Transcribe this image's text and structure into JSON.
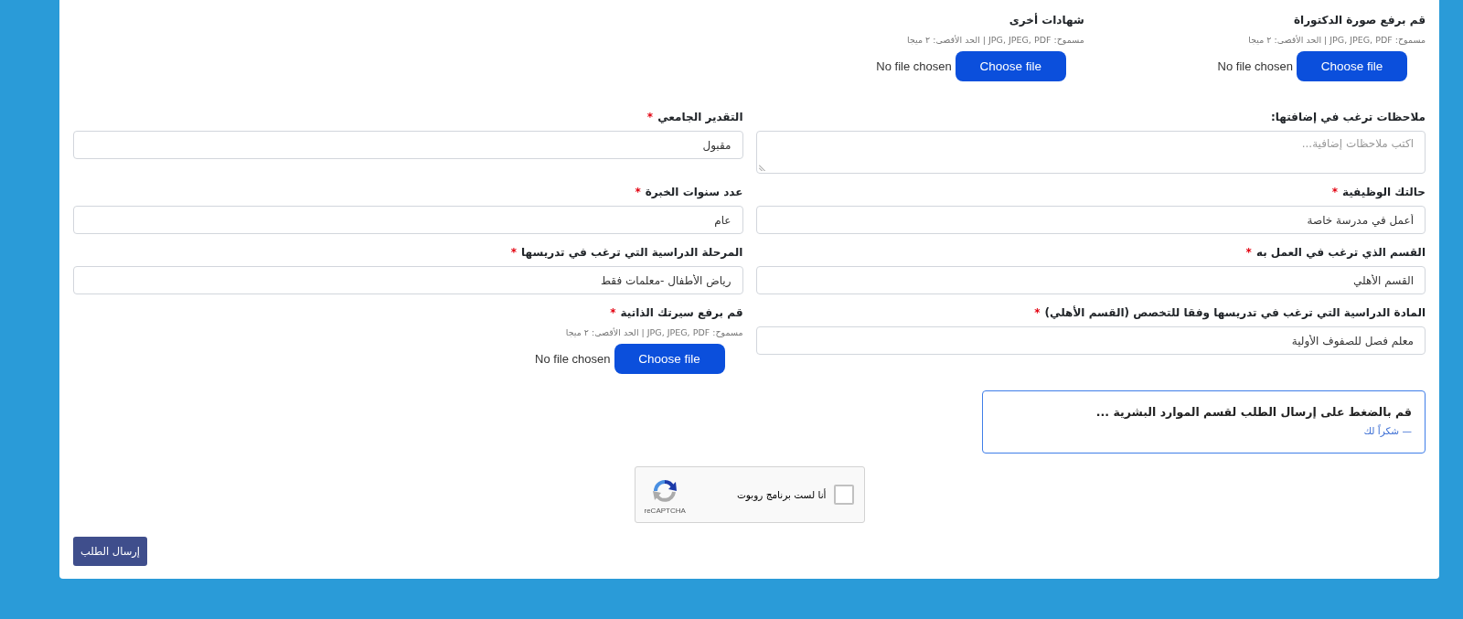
{
  "top_uploads": [
    {
      "kind": "file",
      "label": "قم برفع صورة الدكتوراة",
      "hint": "مسموح: JPG, JPEG, PDF | الحد الأقصى: ٢ ميجا",
      "button": "Choose file",
      "status": "No file chosen"
    },
    {
      "kind": "file",
      "label": "شهادات أخرى",
      "hint": "مسموح: JPG, JPEG, PDF | الحد الأقصى: ٢ ميجا",
      "button": "Choose file",
      "status": "No file chosen"
    }
  ],
  "fields": [
    {
      "kind": "textarea",
      "label": "ملاحظات ترغب في إضافتها:",
      "placeholder": "اكتب ملاحظات إضافية..."
    },
    {
      "kind": "input",
      "label": "التقدير الجامعي",
      "required_mark": "*",
      "value": "مقبول"
    },
    {
      "kind": "input",
      "label": "حالتك الوظيفية",
      "required_mark": "*",
      "value": "أعمل في مدرسة خاصة"
    },
    {
      "kind": "input",
      "label": "عدد سنوات الخبرة",
      "required_mark": "*",
      "value": "عام"
    },
    {
      "kind": "input",
      "label": "القسم الذي ترغب في العمل به",
      "required_mark": "*",
      "value": "القسم الأهلي"
    },
    {
      "kind": "input",
      "label": "المرحلة الدراسية التي ترغب في تدريسها",
      "required_mark": "*",
      "value": "رياض الأطفال -معلمات فقط"
    },
    {
      "kind": "input",
      "label": "المادة الدراسية التي ترغب في تدريسها وفقا للتخصص (القسم الأهلي)",
      "required_mark": "*",
      "value": "معلم فصل للصفوف الأولية"
    },
    {
      "kind": "file",
      "label": "قم برفع سيرتك الذاتية",
      "required_mark": "*",
      "hint": "مسموح: JPG, JPEG, PDF | الحد الأقصى: ٢ ميجا",
      "button": "Choose file",
      "status": "No file chosen"
    }
  ],
  "notice": {
    "message": "قم بالضغط على إرسال الطلب لقسم الموارد البشرية ...",
    "signature": "— شكراً لك"
  },
  "recaptcha": {
    "checked": false,
    "label": "أنا لست برنامج روبوت",
    "brand": "reCAPTCHA"
  },
  "submit": {
    "label": "إرسال الطلب"
  }
}
